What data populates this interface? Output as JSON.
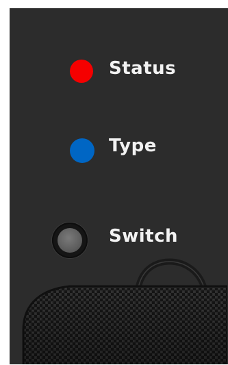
{
  "indicators": {
    "status": {
      "label": "Status",
      "color": "#f50000",
      "icon": "red-led-icon"
    },
    "type": {
      "label": "Type",
      "color": "#0066c4",
      "icon": "blue-led-icon"
    },
    "switch": {
      "label": "Switch",
      "color": "#5e5e5e",
      "icon": "switch-button-icon"
    }
  },
  "theme": {
    "panel_bg": "#2c2c2c",
    "text_color": "#f2f2f2"
  }
}
